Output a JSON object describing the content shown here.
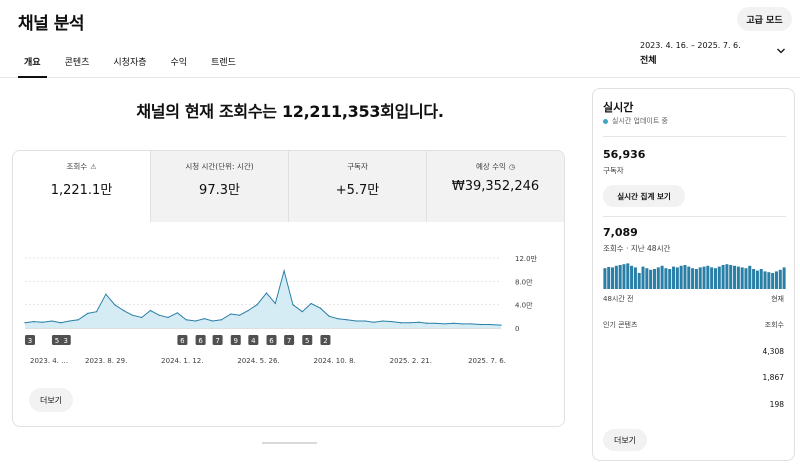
{
  "header": {
    "title": "채널 분석",
    "advanced_mode": "고급 모드",
    "tabs": [
      {
        "label": "개요",
        "active": true
      },
      {
        "label": "콘텐츠",
        "active": false
      },
      {
        "label": "시청자층",
        "active": false
      },
      {
        "label": "수익",
        "active": false
      },
      {
        "label": "트렌드",
        "active": false
      }
    ],
    "date_range": "2023. 4. 16. – 2025. 7. 6.",
    "date_scope": "전체"
  },
  "headline": "채널의 현재 조회수는 12,211,353회입니다.",
  "metrics": [
    {
      "label": "조회수",
      "value": "1,221.1만",
      "icon": "warning-icon"
    },
    {
      "label": "시청 시간(단위: 시간)",
      "value": "97.3만",
      "icon": ""
    },
    {
      "label": "구독자",
      "value": "+5.7만",
      "icon": ""
    },
    {
      "label": "예상 수익",
      "value": "₩39,352,246",
      "icon": "clock-icon"
    }
  ],
  "chart_data": {
    "type": "area",
    "y_ticks": [
      "12.0만",
      "8.0만",
      "4.0만",
      "0"
    ],
    "ylim": [
      0,
      120000
    ],
    "x_ticks": [
      "2023. 4. …",
      "2023. 8. 29.",
      "2024. 1. 12.",
      "2024. 5. 26.",
      "2024. 10. 8.",
      "2025. 2. 21.",
      "2025. 7. 6."
    ],
    "x": [
      "2023-04-16",
      "2023-05-01",
      "2023-05-16",
      "2023-06-01",
      "2023-06-16",
      "2023-07-01",
      "2023-07-16",
      "2023-08-01",
      "2023-08-16",
      "2023-09-01",
      "2023-09-16",
      "2023-10-01",
      "2023-10-16",
      "2023-11-01",
      "2023-11-16",
      "2023-12-01",
      "2023-12-16",
      "2024-01-01",
      "2024-01-16",
      "2024-02-01",
      "2024-02-16",
      "2024-03-01",
      "2024-03-16",
      "2024-04-01",
      "2024-04-16",
      "2024-05-01",
      "2024-05-16",
      "2024-06-01",
      "2024-06-16",
      "2024-07-01",
      "2024-07-16",
      "2024-08-01",
      "2024-08-16",
      "2024-09-01",
      "2024-09-16",
      "2024-10-01",
      "2024-10-16",
      "2024-11-01",
      "2024-11-16",
      "2024-12-01",
      "2024-12-16",
      "2025-01-01",
      "2025-01-16",
      "2025-02-01",
      "2025-02-16",
      "2025-03-01",
      "2025-03-16",
      "2025-04-01",
      "2025-04-16",
      "2025-05-01",
      "2025-05-16",
      "2025-06-01",
      "2025-06-16",
      "2025-07-06"
    ],
    "values": [
      9000,
      11000,
      10000,
      12000,
      9000,
      12000,
      14000,
      25000,
      28000,
      58000,
      40000,
      30000,
      22000,
      18000,
      30000,
      22000,
      18000,
      26000,
      14000,
      12000,
      16000,
      12000,
      14000,
      24000,
      22000,
      30000,
      40000,
      60000,
      42000,
      98000,
      40000,
      28000,
      42000,
      34000,
      20000,
      16000,
      14000,
      12000,
      12000,
      10000,
      12000,
      11000,
      9000,
      9000,
      10000,
      8000,
      8000,
      7000,
      8000,
      7000,
      7000,
      6000,
      6000,
      5000
    ],
    "video_markers": [
      {
        "label": "3",
        "x": "2023-04-16"
      },
      {
        "label": "5",
        "x": "2023-06-01"
      },
      {
        "label": "3",
        "x": "2023-06-16"
      },
      {
        "label": "6",
        "x": "2024-01-01"
      },
      {
        "label": "6",
        "x": "2024-02-01"
      },
      {
        "label": "7",
        "x": "2024-03-01"
      },
      {
        "label": "9",
        "x": "2024-04-01"
      },
      {
        "label": "4",
        "x": "2024-05-01"
      },
      {
        "label": "6",
        "x": "2024-06-01"
      },
      {
        "label": "7",
        "x": "2024-07-01"
      },
      {
        "label": "5",
        "x": "2024-08-01"
      },
      {
        "label": "2",
        "x": "2024-09-01"
      }
    ],
    "colors": {
      "line": "#2a7fa6",
      "fill": "#d6ecf5"
    },
    "grid": true
  },
  "more_label": "더보기",
  "realtime": {
    "title": "실시간",
    "status": "실시간 업데이트 중",
    "status_color": "#3ea6c4",
    "subscribers_value": "56,936",
    "subscribers_label": "구독자",
    "view_summary_button": "실시간 집계 보기",
    "views_value": "7,089",
    "views_label": "조회수 · 지난 48시간",
    "chart_data": {
      "type": "bar",
      "values": [
        52,
        55,
        54,
        58,
        60,
        62,
        64,
        58,
        54,
        40,
        56,
        52,
        48,
        50,
        54,
        58,
        52,
        50,
        56,
        54,
        58,
        60,
        56,
        52,
        50,
        54,
        56,
        58,
        54,
        52,
        56,
        60,
        62,
        60,
        58,
        56,
        54,
        52,
        58,
        50,
        46,
        50,
        44,
        42,
        40,
        44,
        48,
        54
      ],
      "color": "#2a7fa6"
    },
    "axis_start": "48시간 전",
    "axis_end": "현재",
    "table_header_left": "인기 콘텐츠",
    "table_header_right": "조회수",
    "top_content": [
      "4,308",
      "1,867",
      "198"
    ],
    "more_label": "더보기"
  }
}
